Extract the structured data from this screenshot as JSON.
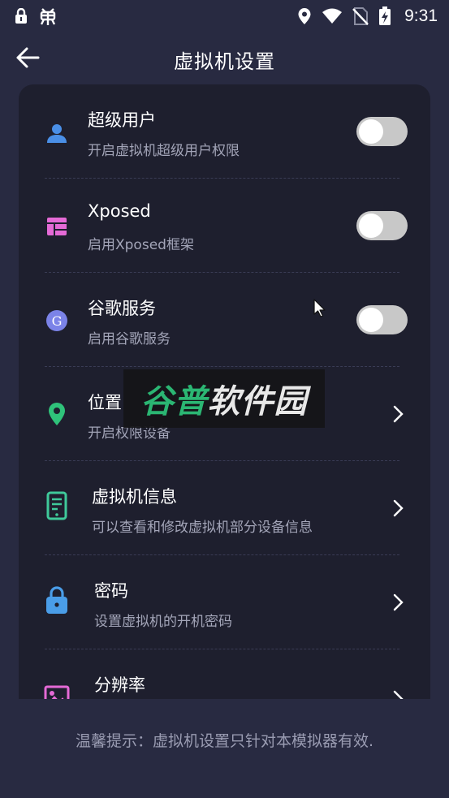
{
  "status_bar": {
    "time": "9:31",
    "left_icons": [
      "lock-icon",
      "bug-icon"
    ],
    "right_icons": [
      "location-icon",
      "wifi-icon",
      "no-sim-icon",
      "battery-charging-icon"
    ]
  },
  "app_bar": {
    "back_icon": "back-arrow-icon",
    "title": "虚拟机设置"
  },
  "settings": [
    {
      "icon": "user-icon",
      "title": "超级用户",
      "subtitle": "开启虚拟机超级用户权限",
      "control": "toggle",
      "on": false
    },
    {
      "icon": "grid-icon",
      "title": "Xposed",
      "subtitle": "启用Xposed框架",
      "control": "toggle",
      "on": false
    },
    {
      "icon": "google-icon",
      "title": "谷歌服务",
      "subtitle": "启用谷歌服务",
      "control": "toggle",
      "on": false
    },
    {
      "icon": "location-pin-icon",
      "title": "位置",
      "subtitle": "开启权限设备",
      "control": "chevron"
    },
    {
      "icon": "phone-info-icon",
      "title": "虚拟机信息",
      "subtitle": "可以查看和修改虚拟机部分设备信息",
      "control": "chevron"
    },
    {
      "icon": "lock-icon",
      "title": "密码",
      "subtitle": "设置虚拟机的开机密码",
      "control": "chevron"
    },
    {
      "icon": "image-icon",
      "title": "分辨率",
      "subtitle": "",
      "control": "chevron"
    }
  ],
  "hint": "温馨提示：虚拟机设置只针对本模拟器有效.",
  "watermark": {
    "part1": "谷普",
    "part2": "软件园"
  },
  "colors": {
    "background": "#282a41",
    "card": "#1e1f2e",
    "user_icon": "#4a8fe7",
    "grid_icon": "#e56ad6",
    "google_icon": "#7b83e8",
    "pin_icon": "#2fc27a",
    "phone_icon": "#3fc99a",
    "lock_icon": "#4a9de8",
    "image_icon": "#e56ad6"
  }
}
